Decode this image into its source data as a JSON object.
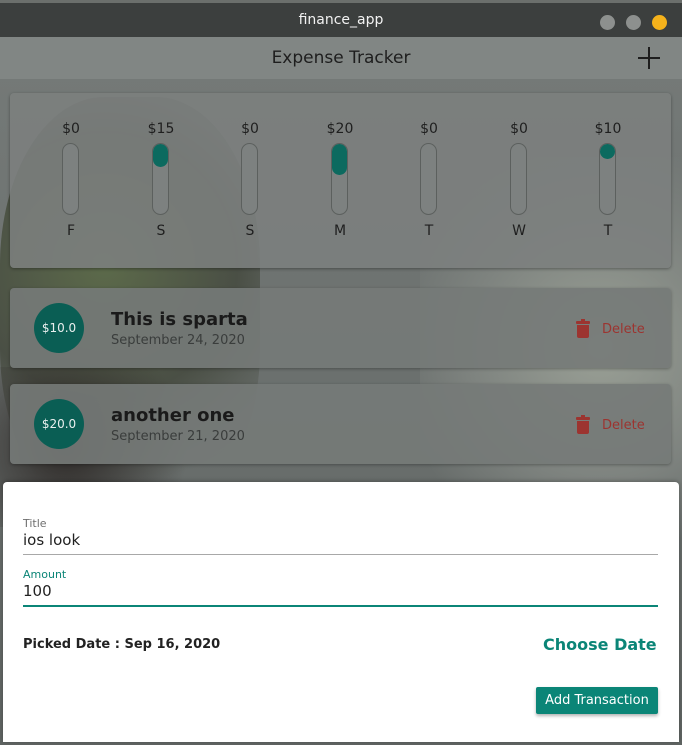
{
  "window": {
    "title": "finance_app"
  },
  "appbar": {
    "title": "Expense Tracker",
    "add_icon": "plus-icon"
  },
  "chart": {
    "bars": [
      {
        "day": "F",
        "amount": "$0",
        "fill_fraction": 0
      },
      {
        "day": "S",
        "amount": "$15",
        "fill_fraction": 0.33
      },
      {
        "day": "S",
        "amount": "$0",
        "fill_fraction": 0
      },
      {
        "day": "M",
        "amount": "$20",
        "fill_fraction": 0.44
      },
      {
        "day": "T",
        "amount": "$0",
        "fill_fraction": 0
      },
      {
        "day": "W",
        "amount": "$0",
        "fill_fraction": 0
      },
      {
        "day": "T",
        "amount": "$10",
        "fill_fraction": 0.22
      }
    ],
    "bar_color": "#0c6a5f"
  },
  "transactions": [
    {
      "amount": "$10.0",
      "title": "This is sparta",
      "date": "September 24, 2020",
      "delete_label": "Delete"
    },
    {
      "amount": "$20.0",
      "title": "another one",
      "date": "September 21, 2020",
      "delete_label": "Delete"
    }
  ],
  "form": {
    "title_label": "Title",
    "title_value": "ios look",
    "amount_label": "Amount",
    "amount_value": "100",
    "picked_date": "Picked Date : Sep 16, 2020",
    "choose_date_label": "Choose Date",
    "submit_label": "Add Transaction"
  },
  "colors": {
    "accent": "#0b8577",
    "delete": "#c0392b",
    "window_close": "#f5b21b"
  }
}
